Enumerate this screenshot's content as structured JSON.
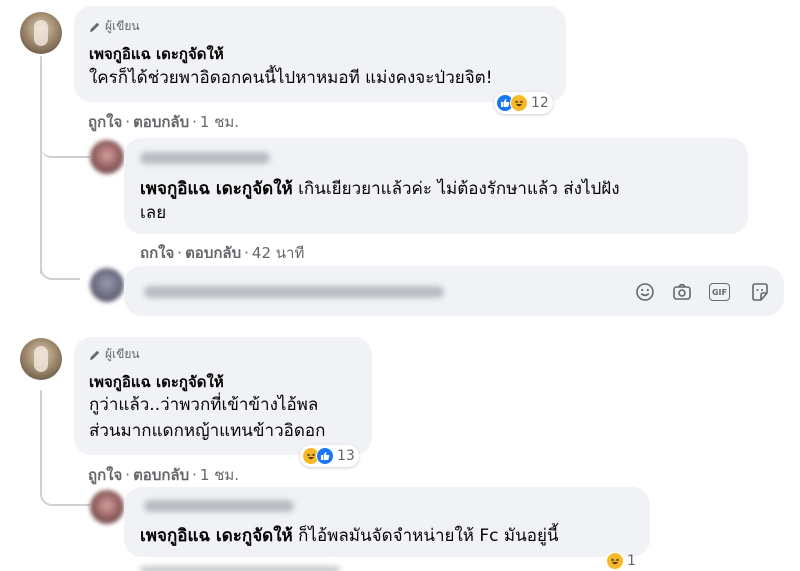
{
  "comment1": {
    "badge": "ผู้เขียน",
    "name": "เพจกูอิแฉ เดะกูจัดให้",
    "text": "ใครก็ได้ช่วยพาอิดอกคนนี้ไปหาหมอที แม่งคงจะป่วยจิต!",
    "reaction_count": "12",
    "like": "ถูกใจ",
    "reply": "ตอบกลับ",
    "time": "1 ชม."
  },
  "reply1": {
    "tag": "เพจกูอิแฉ เดะกูจัดให้",
    "text_line1": " เกินเยียวยาแล้วค่ะ ไม่ต้องรักษาแล้ว ส่งไปฝัง",
    "text_line2": "เลย",
    "like": "ถูกใจ",
    "reply": "ตอบกลับ",
    "time": "42 นาที"
  },
  "composer": {
    "icons": [
      "emoji-icon",
      "camera-icon",
      "gif-icon",
      "sticker-icon"
    ],
    "gif_label": "GIF"
  },
  "comment2": {
    "badge": "ผู้เขียน",
    "name": "เพจกูอิแฉ เดะกูจัดให้",
    "text_line1": "กูว่าแล้ว..ว่าพวกที่เข้าข้างไอ้พล",
    "text_line2": "ส่วนมากแดกหญ้าแทนข้าวอิดอก",
    "reaction_count": "13",
    "like": "ถูกใจ",
    "reply": "ตอบกลับ",
    "time": "1 ชม."
  },
  "reply2": {
    "tag": "เพจกูอิแฉ เดะกูจัดให้",
    "text": " ก็ไอ้พลมันจัดจำหน่ายให้ Fc มันอยู่นี้",
    "reaction_count": "1"
  },
  "colors": {
    "bubble": "#f0f2f5",
    "secondary_text": "#65676b",
    "like_blue": "#1877f2",
    "haha_yellow": "#f7b928"
  }
}
